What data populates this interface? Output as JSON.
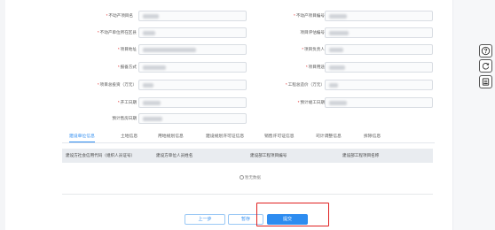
{
  "form": {
    "fields": [
      {
        "key": "project_name",
        "label": "不动产项目名",
        "required": true
      },
      {
        "key": "project_code",
        "label": "不动产项目编号",
        "required": true
      },
      {
        "key": "district",
        "label": "不动产单位所在区县",
        "required": true
      },
      {
        "key": "approval_no",
        "label": "项目评估编号",
        "required": false
      },
      {
        "key": "address",
        "label": "项目地址",
        "required": true
      },
      {
        "key": "owner",
        "label": "项目负责人",
        "required": true
      },
      {
        "key": "method",
        "label": "报备方式",
        "required": true
      },
      {
        "key": "purpose",
        "label": "项目用途",
        "required": true
      },
      {
        "key": "investment",
        "label": "项目总投资（万元）",
        "required": true
      },
      {
        "key": "cost",
        "label": "工程总造价（万元）",
        "required": true
      },
      {
        "key": "start_date",
        "label": "开工日期",
        "required": true
      },
      {
        "key": "end_date",
        "label": "预计竣工日期",
        "required": true
      },
      {
        "key": "delivery_date",
        "label": "预计售房日期",
        "required": false
      }
    ]
  },
  "tabs": [
    {
      "label": "建设单位信息",
      "active": true
    },
    {
      "label": "土地信息",
      "active": false
    },
    {
      "label": "用地规划信息",
      "active": false
    },
    {
      "label": "建设规划许可证信息",
      "active": false
    },
    {
      "label": "销售许可证信息",
      "active": false
    },
    {
      "label": "司计调整信息",
      "active": false
    },
    {
      "label": "拆除信息",
      "active": false
    }
  ],
  "table": {
    "columns": [
      "建设方社会信用代码（组织人员证号）",
      "建设方单位人员姓名",
      "建设部工程项目编号",
      "建设部工程项目名称"
    ],
    "empty_text": "暂无数据"
  },
  "actions": {
    "prev_label": "上一步",
    "save_label": "暂存",
    "submit_label": "提交"
  },
  "sidebar": {
    "icons": [
      "help-icon",
      "refresh-icon",
      "document-icon"
    ]
  },
  "colors": {
    "accent": "#2d8cf0",
    "required": "#e02020",
    "highlight": "#e02020"
  }
}
